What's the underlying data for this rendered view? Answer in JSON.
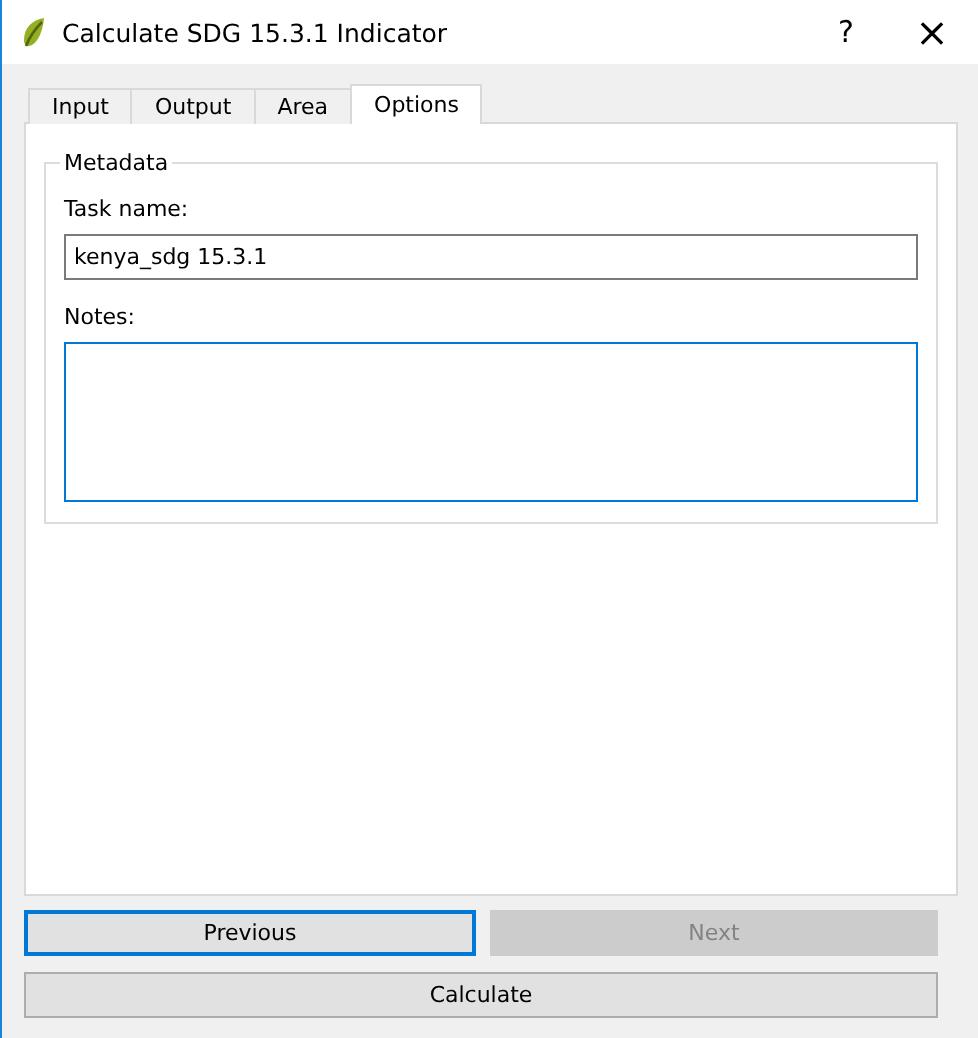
{
  "window": {
    "title": "Calculate SDG 15.3.1 Indicator",
    "help": "?",
    "close": "×"
  },
  "tabs": [
    {
      "label": "Input",
      "selected": false
    },
    {
      "label": "Output",
      "selected": false
    },
    {
      "label": "Area",
      "selected": false
    },
    {
      "label": "Options",
      "selected": true
    }
  ],
  "metadata": {
    "title": "Metadata",
    "task_name": {
      "label": "Task name:",
      "value": "kenya_sdg 15.3.1"
    },
    "notes": {
      "label": "Notes:",
      "focused": true
    }
  },
  "nav_buttons": [
    {
      "label": "Previous",
      "disabled": false,
      "focused": true
    },
    {
      "label": "Next",
      "disabled": true,
      "focused": false
    }
  ],
  "calculate_button": {
    "label": "Calculate"
  }
}
